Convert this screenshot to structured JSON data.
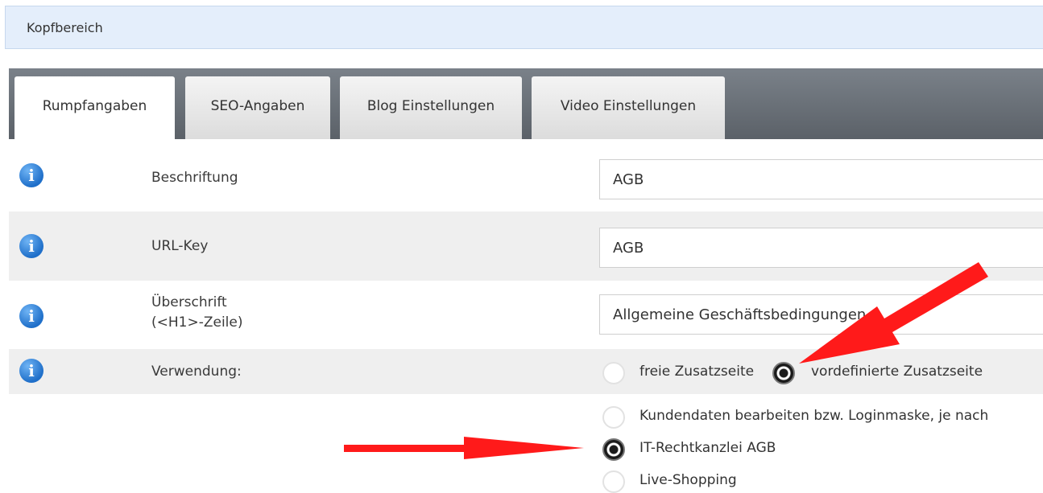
{
  "header": {
    "title": "Kopfbereich"
  },
  "tabs": [
    {
      "label": "Rumpfangaben",
      "active": true
    },
    {
      "label": "SEO-Angaben",
      "active": false
    },
    {
      "label": "Blog Einstellungen",
      "active": false
    },
    {
      "label": "Video Einstellungen",
      "active": false
    }
  ],
  "fields": {
    "beschriftung": {
      "label": "Beschriftung",
      "value": "AGB"
    },
    "url_key": {
      "label": "URL-Key",
      "value": "AGB"
    },
    "ueberschrift": {
      "label_line1": "Überschrift",
      "label_line2": "(<H1>-Zeile)",
      "value": "Allgemeine Geschäftsbedingungen"
    },
    "verwendung": {
      "label": "Verwendung:",
      "options": [
        {
          "label": "freie Zusatzseite",
          "selected": false
        },
        {
          "label": "vordefinierte Zusatzseite",
          "selected": true
        }
      ]
    }
  },
  "predefined_pages": [
    {
      "label": "Kundendaten bearbeiten bzw. Loginmaske, je nach",
      "selected": false
    },
    {
      "label": "IT-Rechtkanzlei AGB",
      "selected": true
    },
    {
      "label": "Live-Shopping",
      "selected": false
    }
  ],
  "colors": {
    "arrow": "#ff1a1a",
    "info_icon": "#1f6fc9",
    "tab_strip": "#646a71"
  }
}
